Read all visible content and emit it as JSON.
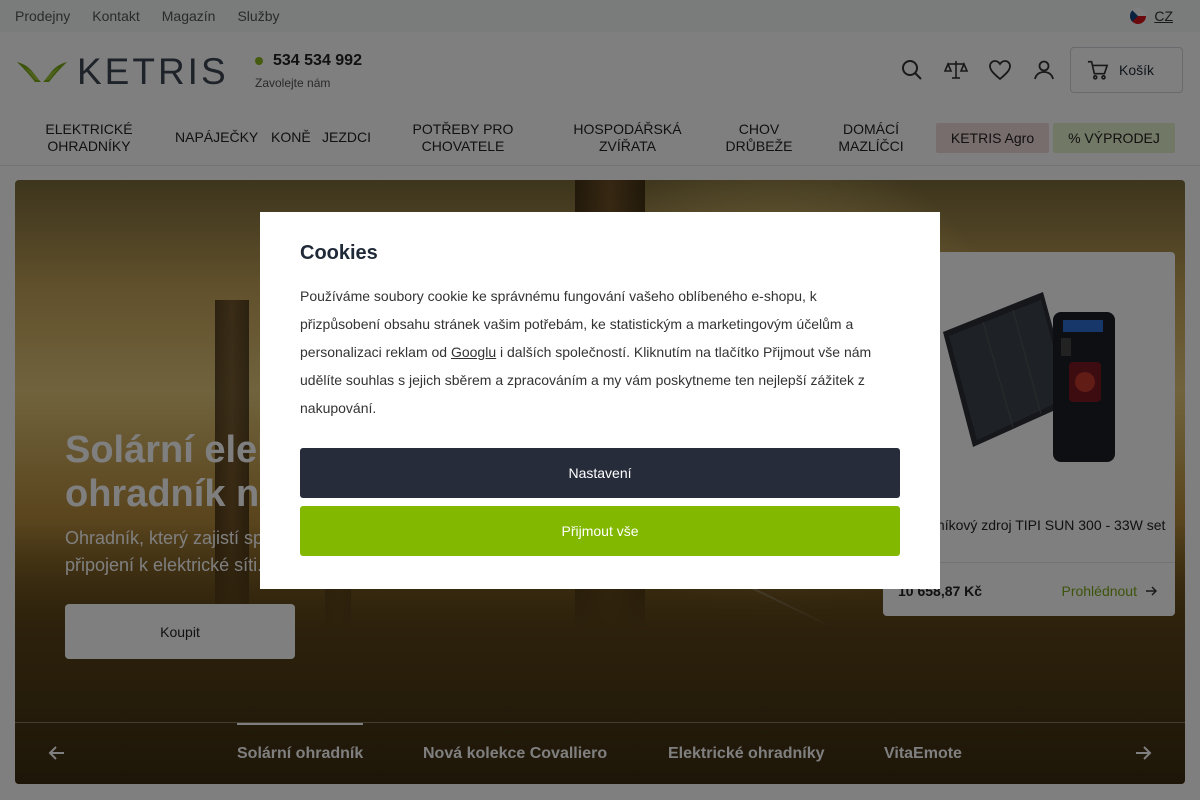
{
  "topbar": {
    "links": [
      "Prodejny",
      "Kontakt",
      "Magazín",
      "Služby"
    ],
    "language": "CZ"
  },
  "header": {
    "brand": "KETRIS",
    "phone": "534 534 992",
    "phone_sub": "Zavolejte nám",
    "cart_label": "Košík",
    "icons": [
      "search-icon",
      "compare-icon",
      "heart-icon",
      "user-icon",
      "cart-icon"
    ]
  },
  "nav": {
    "items": [
      {
        "label": "ELEKTRICKÉ OHRADNÍKY"
      },
      {
        "label": "NAPÁJEČKY"
      },
      {
        "label": "KONĚ"
      },
      {
        "label": "JEZDCI"
      },
      {
        "label": "POTŘEBY PRO CHOVATELE"
      },
      {
        "label": "HOSPODÁŘSKÁ ZVÍŘATA"
      },
      {
        "label": "CHOV DRŮBEŽE"
      },
      {
        "label": "DOMÁCÍ MAZLÍČCI"
      }
    ],
    "agro": "KETRIS Agro",
    "sale": "% VÝPRODEJ"
  },
  "hero": {
    "title_line1": "Solární elektrický",
    "title_line2": "ohradník na pastvinu",
    "subtitle_line1": "Ohradník, který zajistí spolehlivou ochranu i bez",
    "subtitle_line2": "připojení k elektrické síti.",
    "button": "Koupit",
    "product": {
      "name": "Ohradníkový zdroj TIPI SUN 300 - 33W set",
      "price": "10 658,87 Kč",
      "link": "Prohlédnout"
    },
    "tabs": [
      "Solární ohradník",
      "Nová kolekce Covalliero",
      "Elektrické ohradníky",
      "VitaEmote"
    ]
  },
  "cookies": {
    "title": "Cookies",
    "text_before_link": "Používáme soubory cookie ke správnému fungování vašeho oblíbeného e-shopu, k přizpůsobení obsahu stránek vašim potřebám, ke statistickým a marketingovým účelům a personalizaci reklam od ",
    "link": "Googlu",
    "text_after_link": " i dalších společností. Kliknutím na tlačítko Přijmout vše nám udělíte souhlas s jejich sběrem a zpracováním a my vám poskytneme ten nejlepší zážitek z nakupování.",
    "settings_button": "Nastavení",
    "accept_button": "Přijmout vše"
  },
  "colors": {
    "accent_green": "#83b800",
    "dark_button": "#272c3a",
    "overlay": "rgba(0,0,0,0.5)"
  }
}
